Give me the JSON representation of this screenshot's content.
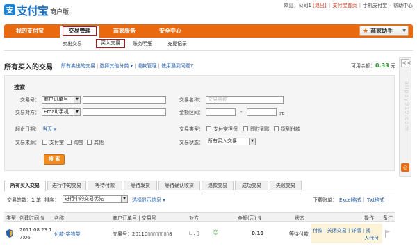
{
  "header": {
    "logo_mark": "支",
    "logo_text": "支付宝",
    "logo_sub": "商户版",
    "welcome": "欢迎，公司1",
    "logout": "[退出]",
    "home": "支付宝首页",
    "mobile": "手机支付宝",
    "help": "帮助中心"
  },
  "nav": {
    "items": [
      "我的支付宝",
      "交易管理",
      "商家服务",
      "安全中心"
    ],
    "helper": "商家助手"
  },
  "subnav": {
    "items": [
      "卖出交易",
      "买入交易",
      "账务明细",
      "充提记录"
    ]
  },
  "page": {
    "title": "所有买入的交易",
    "links": [
      "所有卖出的交易",
      "选择其他分类",
      "退款管理",
      "使用遇到问题?"
    ],
    "balance_label": "可用余额：",
    "balance": "0.33",
    "balance_unit": "元"
  },
  "side": {
    "collapse": "<<",
    "watermark": "alipay919.com",
    "icon": "◎"
  },
  "search": {
    "heading": "搜索",
    "trade_no_label": "交易号：",
    "trade_no_type": "商户订单号",
    "party_label": "交易对方：",
    "party_type": "Email/手机",
    "start_date_label": "起止日期：",
    "start_date_value": "当天",
    "source_label": "交易来源：",
    "sources": [
      "支付宝",
      "淘宝",
      "其他"
    ],
    "name_label": "交易名称：",
    "name_placeholder": "交易名称",
    "amount_label": "金额区间：",
    "amount_dash": "-",
    "amount_unit": "元",
    "type_label": "交易类型：",
    "types": [
      "支付宝担保",
      "即时到账",
      "货到付款"
    ],
    "status_label": "交易状态：",
    "status_value": "所有买入交易",
    "button": "搜 索"
  },
  "tabs": [
    "所有买入交易",
    "进行中的交易",
    "等待付款",
    "等待发货",
    "等待确认收货",
    "退款交易",
    "成功交易",
    "失败交易"
  ],
  "list": {
    "count_label": "交易笔数：",
    "count": "1",
    "count_unit": "笔",
    "sort_label": "排序：",
    "sort_value": "进行中的交易优先",
    "options": "选择显示信息",
    "download_label": "下载账单：",
    "excel": "Excel格式",
    "txt": "Txt格式"
  },
  "table": {
    "headers": [
      "类型",
      "创建时间",
      "名称",
      "商户订单号 | 交易号",
      "对方",
      "金额(元)",
      "状态",
      "操作",
      "备注"
    ],
    "row": {
      "time_line1": "2011.08.23 1",
      "time_line2": "7:06",
      "name": "付款-实物类",
      "trade": "交易号：20110▯▯▯▯▯▯▯▯8",
      "party": "i... ▯",
      "amount": "0.10",
      "status": "等待付款",
      "ops_line1": "付款 | 关闭交易 | 详情 | 找",
      "ops_line2": "人代付"
    }
  },
  "colors": {
    "orange": "#e9690e",
    "link": "#1f5fb0",
    "highlight": "#c0101a",
    "balance": "#2a9a2a"
  }
}
